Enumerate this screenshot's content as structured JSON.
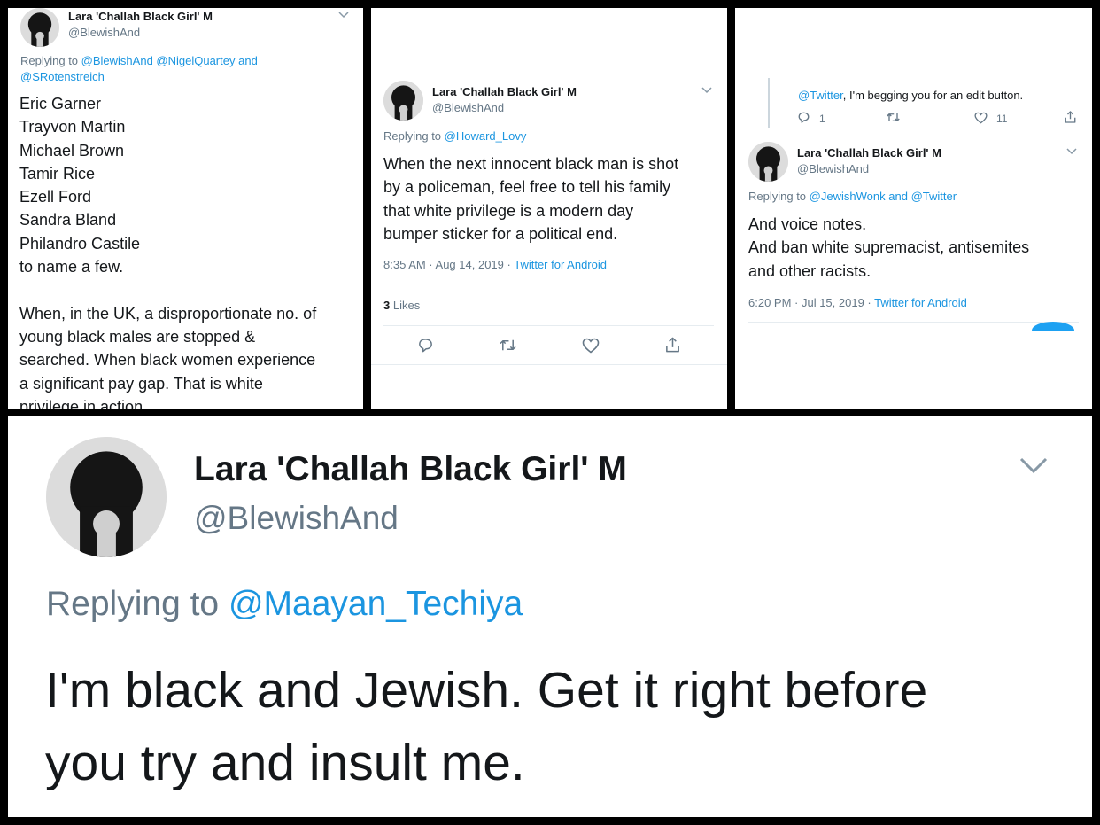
{
  "panel1": {
    "name": "Lara 'Challah Black Girl' M",
    "handle": "@BlewishAnd",
    "reply_prefix": "Replying to",
    "reply_links_1": "@BlewishAnd @NigelQuartey",
    "reply_and": "and",
    "reply_links_2": "@SRotenstreich",
    "lines": [
      "Eric Garner",
      "Trayvon Martin",
      "Michael Brown",
      "Tamir Rice",
      "Ezell Ford",
      "Sandra Bland",
      "Philandro Castile",
      "to name a few.",
      "",
      "When, in the UK, a disproportionate no. of",
      "young black males are stopped &",
      "searched. When black women experience",
      "a significant pay gap. That is white",
      "privilege in action."
    ]
  },
  "panel2": {
    "name": "Lara 'Challah Black Girl' M",
    "handle": "@BlewishAnd",
    "reply_prefix": "Replying to",
    "reply_link": "@Howard_Lovy",
    "lines": [
      "When the next innocent black man is shot",
      "by a policeman, feel free to tell his family",
      "that white privilege is a modern day",
      "bumper sticker for a political end."
    ],
    "timestamp": "8:35 AM · Aug 14, 2019 ·",
    "source": "Twitter for Android",
    "likes_count": "3",
    "likes_label": "Likes"
  },
  "panel3": {
    "prev_link": "@Twitter",
    "prev_text": ", I'm begging you for an edit button.",
    "prev_replies": "1",
    "prev_likes": "11",
    "name": "Lara 'Challah Black Girl' M",
    "handle": "@BlewishAnd",
    "reply_prefix": "Replying to",
    "reply_link_1": "@JewishWonk",
    "reply_and": "and",
    "reply_link_2": "@Twitter",
    "lines": [
      "And voice notes.",
      "And ban white supremacist, antisemites",
      "and other racists."
    ],
    "timestamp": "6:20 PM · Jul 15, 2019 ·",
    "source": "Twitter for Android"
  },
  "panel4": {
    "name": "Lara 'Challah Black Girl' M",
    "handle": "@BlewishAnd",
    "reply_prefix": "Replying to",
    "reply_link": "@Maayan_Techiya",
    "lines": [
      "I'm black and Jewish. Get it right before",
      "you try and insult me."
    ]
  },
  "colors": {
    "link": "#1b95e0",
    "muted": "#657786",
    "text": "#14171a",
    "frame": "#000000"
  },
  "icons": [
    "chevron-down-icon",
    "reply-icon",
    "retweet-icon",
    "like-icon",
    "share-icon"
  ]
}
